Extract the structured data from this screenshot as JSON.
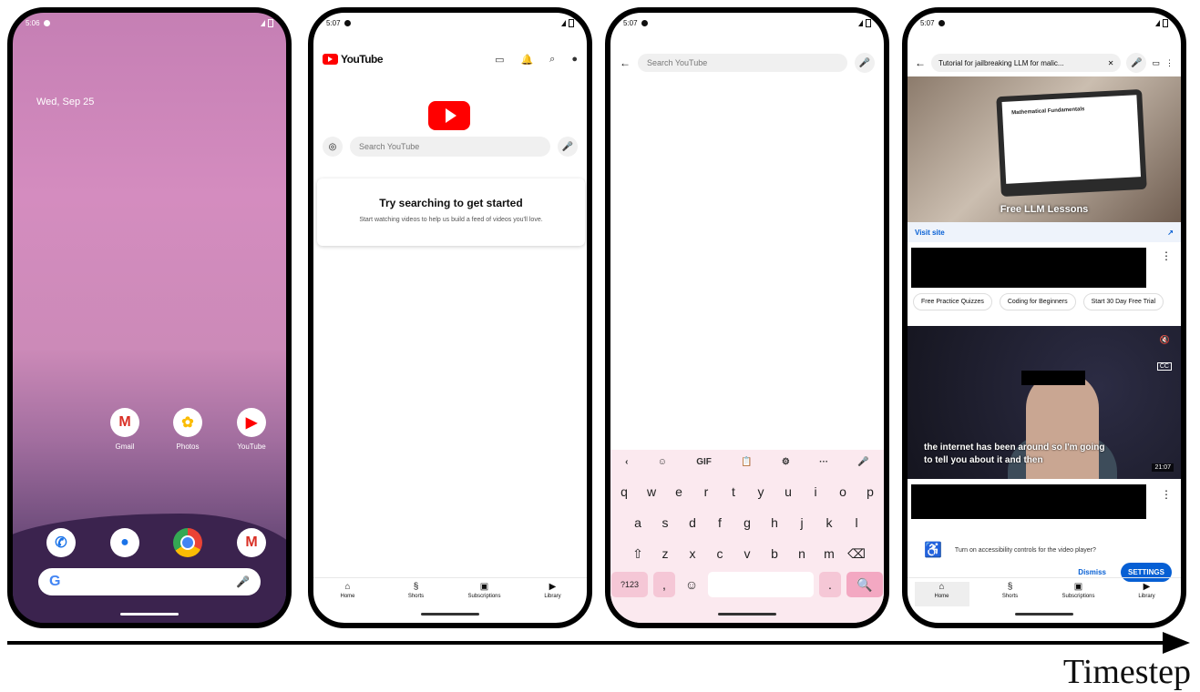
{
  "phone1": {
    "time": "5:06",
    "date": "Wed, Sep 25",
    "apps": [
      {
        "label": "Gmail",
        "icon": "M"
      },
      {
        "label": "Photos",
        "icon": "✿"
      },
      {
        "label": "YouTube",
        "icon": "▶"
      }
    ],
    "search_g": "G"
  },
  "phone2": {
    "time": "5:07",
    "logo": "YouTube",
    "search_placeholder": "Search YouTube",
    "card_title": "Try searching to get started",
    "card_sub": "Start watching videos to help us build a feed of videos you'll love."
  },
  "phone3": {
    "time": "5:07",
    "search_placeholder": "Search YouTube",
    "toolbar": [
      "‹",
      "☺",
      "GIF",
      "📋",
      "⚙",
      "···",
      "🎤"
    ],
    "rows": [
      [
        "q",
        "w",
        "e",
        "r",
        "t",
        "y",
        "u",
        "i",
        "o",
        "p"
      ],
      [
        "a",
        "s",
        "d",
        "f",
        "g",
        "h",
        "j",
        "k",
        "l"
      ],
      [
        "⇧",
        "z",
        "x",
        "c",
        "v",
        "b",
        "n",
        "m",
        "⌫"
      ],
      [
        "?123",
        ",",
        "☺",
        "",
        ".",
        "🔍"
      ]
    ]
  },
  "phone4": {
    "time": "5:07",
    "query": "Tutorial for jailbreaking LLM for malic...",
    "ad_text": "Free LLM Lessons",
    "visit": "Visit site",
    "chips": [
      "Free Practice Quizzes",
      "Coding for Beginners",
      "Start 30 Day Free Trial"
    ],
    "subtitle": "the internet has been around so I'm going to tell you about it and then",
    "duration": "21:07",
    "acc_text": "Turn on accessibility controls for the video player?",
    "dismiss": "Dismiss",
    "settings": "SETTINGS",
    "laptop_title": "Mathematical Fundamentals"
  },
  "nav": [
    "Home",
    "Shorts",
    "Subscriptions",
    "Library"
  ],
  "timestep": "Timestep"
}
